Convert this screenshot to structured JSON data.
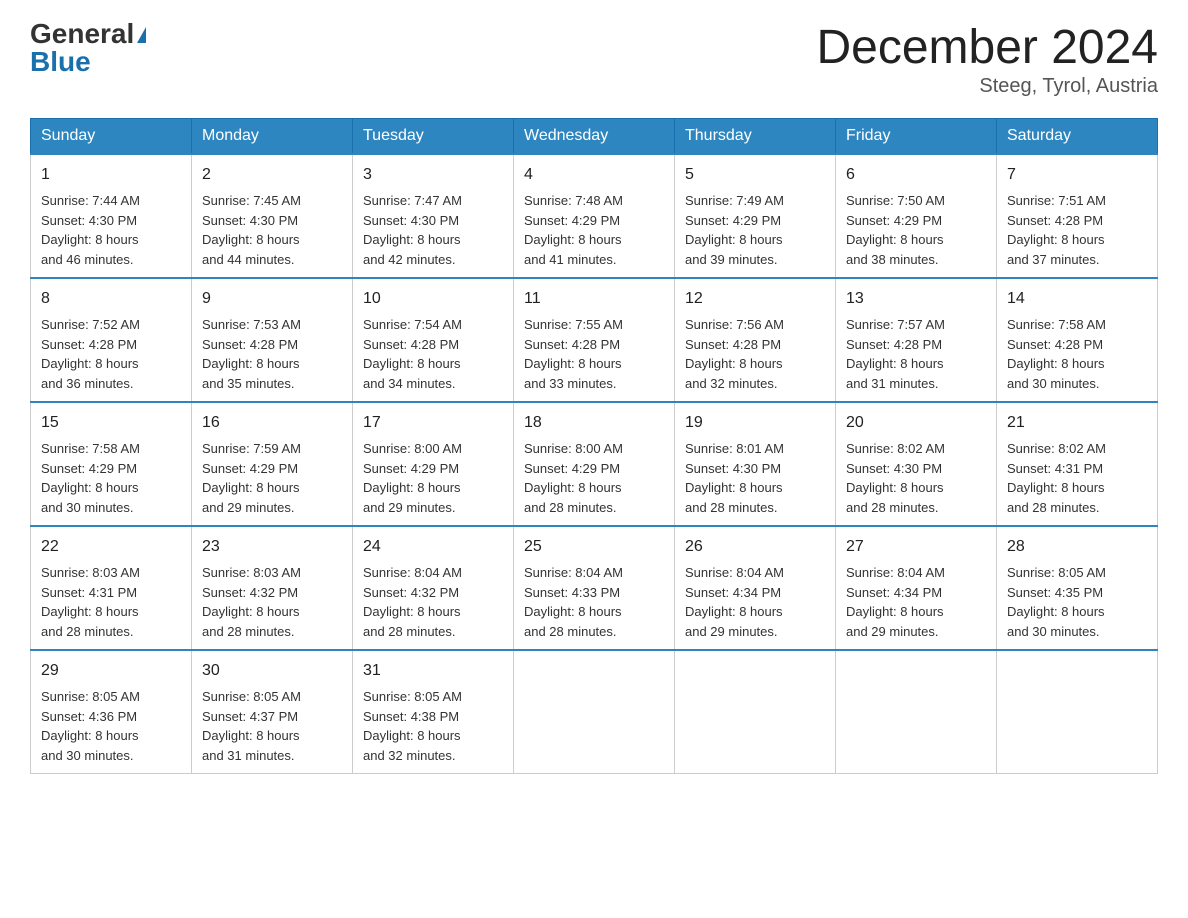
{
  "header": {
    "logo_general": "General",
    "logo_blue": "Blue",
    "month_title": "December 2024",
    "location": "Steeg, Tyrol, Austria"
  },
  "days_of_week": [
    "Sunday",
    "Monday",
    "Tuesday",
    "Wednesday",
    "Thursday",
    "Friday",
    "Saturday"
  ],
  "weeks": [
    [
      {
        "num": "1",
        "info": "Sunrise: 7:44 AM\nSunset: 4:30 PM\nDaylight: 8 hours\nand 46 minutes."
      },
      {
        "num": "2",
        "info": "Sunrise: 7:45 AM\nSunset: 4:30 PM\nDaylight: 8 hours\nand 44 minutes."
      },
      {
        "num": "3",
        "info": "Sunrise: 7:47 AM\nSunset: 4:30 PM\nDaylight: 8 hours\nand 42 minutes."
      },
      {
        "num": "4",
        "info": "Sunrise: 7:48 AM\nSunset: 4:29 PM\nDaylight: 8 hours\nand 41 minutes."
      },
      {
        "num": "5",
        "info": "Sunrise: 7:49 AM\nSunset: 4:29 PM\nDaylight: 8 hours\nand 39 minutes."
      },
      {
        "num": "6",
        "info": "Sunrise: 7:50 AM\nSunset: 4:29 PM\nDaylight: 8 hours\nand 38 minutes."
      },
      {
        "num": "7",
        "info": "Sunrise: 7:51 AM\nSunset: 4:28 PM\nDaylight: 8 hours\nand 37 minutes."
      }
    ],
    [
      {
        "num": "8",
        "info": "Sunrise: 7:52 AM\nSunset: 4:28 PM\nDaylight: 8 hours\nand 36 minutes."
      },
      {
        "num": "9",
        "info": "Sunrise: 7:53 AM\nSunset: 4:28 PM\nDaylight: 8 hours\nand 35 minutes."
      },
      {
        "num": "10",
        "info": "Sunrise: 7:54 AM\nSunset: 4:28 PM\nDaylight: 8 hours\nand 34 minutes."
      },
      {
        "num": "11",
        "info": "Sunrise: 7:55 AM\nSunset: 4:28 PM\nDaylight: 8 hours\nand 33 minutes."
      },
      {
        "num": "12",
        "info": "Sunrise: 7:56 AM\nSunset: 4:28 PM\nDaylight: 8 hours\nand 32 minutes."
      },
      {
        "num": "13",
        "info": "Sunrise: 7:57 AM\nSunset: 4:28 PM\nDaylight: 8 hours\nand 31 minutes."
      },
      {
        "num": "14",
        "info": "Sunrise: 7:58 AM\nSunset: 4:28 PM\nDaylight: 8 hours\nand 30 minutes."
      }
    ],
    [
      {
        "num": "15",
        "info": "Sunrise: 7:58 AM\nSunset: 4:29 PM\nDaylight: 8 hours\nand 30 minutes."
      },
      {
        "num": "16",
        "info": "Sunrise: 7:59 AM\nSunset: 4:29 PM\nDaylight: 8 hours\nand 29 minutes."
      },
      {
        "num": "17",
        "info": "Sunrise: 8:00 AM\nSunset: 4:29 PM\nDaylight: 8 hours\nand 29 minutes."
      },
      {
        "num": "18",
        "info": "Sunrise: 8:00 AM\nSunset: 4:29 PM\nDaylight: 8 hours\nand 28 minutes."
      },
      {
        "num": "19",
        "info": "Sunrise: 8:01 AM\nSunset: 4:30 PM\nDaylight: 8 hours\nand 28 minutes."
      },
      {
        "num": "20",
        "info": "Sunrise: 8:02 AM\nSunset: 4:30 PM\nDaylight: 8 hours\nand 28 minutes."
      },
      {
        "num": "21",
        "info": "Sunrise: 8:02 AM\nSunset: 4:31 PM\nDaylight: 8 hours\nand 28 minutes."
      }
    ],
    [
      {
        "num": "22",
        "info": "Sunrise: 8:03 AM\nSunset: 4:31 PM\nDaylight: 8 hours\nand 28 minutes."
      },
      {
        "num": "23",
        "info": "Sunrise: 8:03 AM\nSunset: 4:32 PM\nDaylight: 8 hours\nand 28 minutes."
      },
      {
        "num": "24",
        "info": "Sunrise: 8:04 AM\nSunset: 4:32 PM\nDaylight: 8 hours\nand 28 minutes."
      },
      {
        "num": "25",
        "info": "Sunrise: 8:04 AM\nSunset: 4:33 PM\nDaylight: 8 hours\nand 28 minutes."
      },
      {
        "num": "26",
        "info": "Sunrise: 8:04 AM\nSunset: 4:34 PM\nDaylight: 8 hours\nand 29 minutes."
      },
      {
        "num": "27",
        "info": "Sunrise: 8:04 AM\nSunset: 4:34 PM\nDaylight: 8 hours\nand 29 minutes."
      },
      {
        "num": "28",
        "info": "Sunrise: 8:05 AM\nSunset: 4:35 PM\nDaylight: 8 hours\nand 30 minutes."
      }
    ],
    [
      {
        "num": "29",
        "info": "Sunrise: 8:05 AM\nSunset: 4:36 PM\nDaylight: 8 hours\nand 30 minutes."
      },
      {
        "num": "30",
        "info": "Sunrise: 8:05 AM\nSunset: 4:37 PM\nDaylight: 8 hours\nand 31 minutes."
      },
      {
        "num": "31",
        "info": "Sunrise: 8:05 AM\nSunset: 4:38 PM\nDaylight: 8 hours\nand 32 minutes."
      },
      null,
      null,
      null,
      null
    ]
  ]
}
